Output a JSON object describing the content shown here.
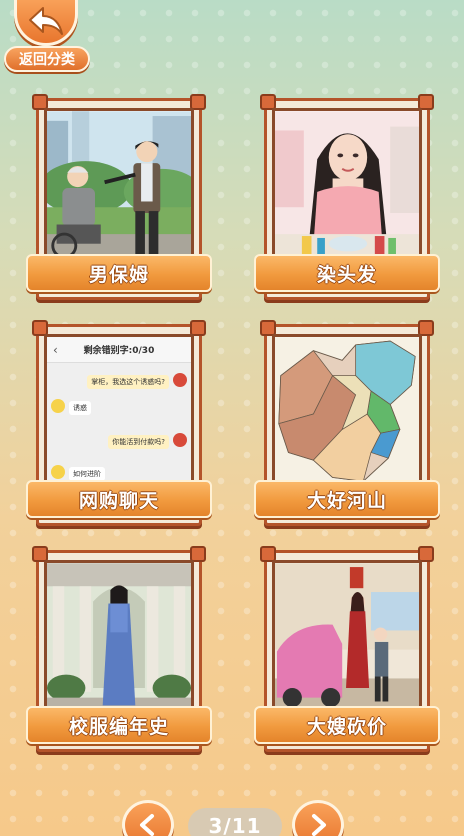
{
  "nav": {
    "back_label": "返回分类"
  },
  "cards": [
    {
      "title": "男保姆"
    },
    {
      "title": "染头发"
    },
    {
      "title": "网购聊天",
      "chat": {
        "header": "剩余错别字:0/30",
        "msg1": "掌柜，我选这个诱惑吗?",
        "msg2": "诱惑",
        "msg3": "你能活到付款吗?",
        "msg4": "如何进阶"
      }
    },
    {
      "title": "大好河山"
    },
    {
      "title": "校服编年史"
    },
    {
      "title": "大嫂砍价"
    }
  ],
  "pager": {
    "indicator": "3/11"
  },
  "colors": {
    "accent": "#f19a3e",
    "frame": "#b4542a"
  },
  "icons": [
    "back-arrow-icon",
    "chevron-left-icon",
    "chevron-right-icon"
  ]
}
